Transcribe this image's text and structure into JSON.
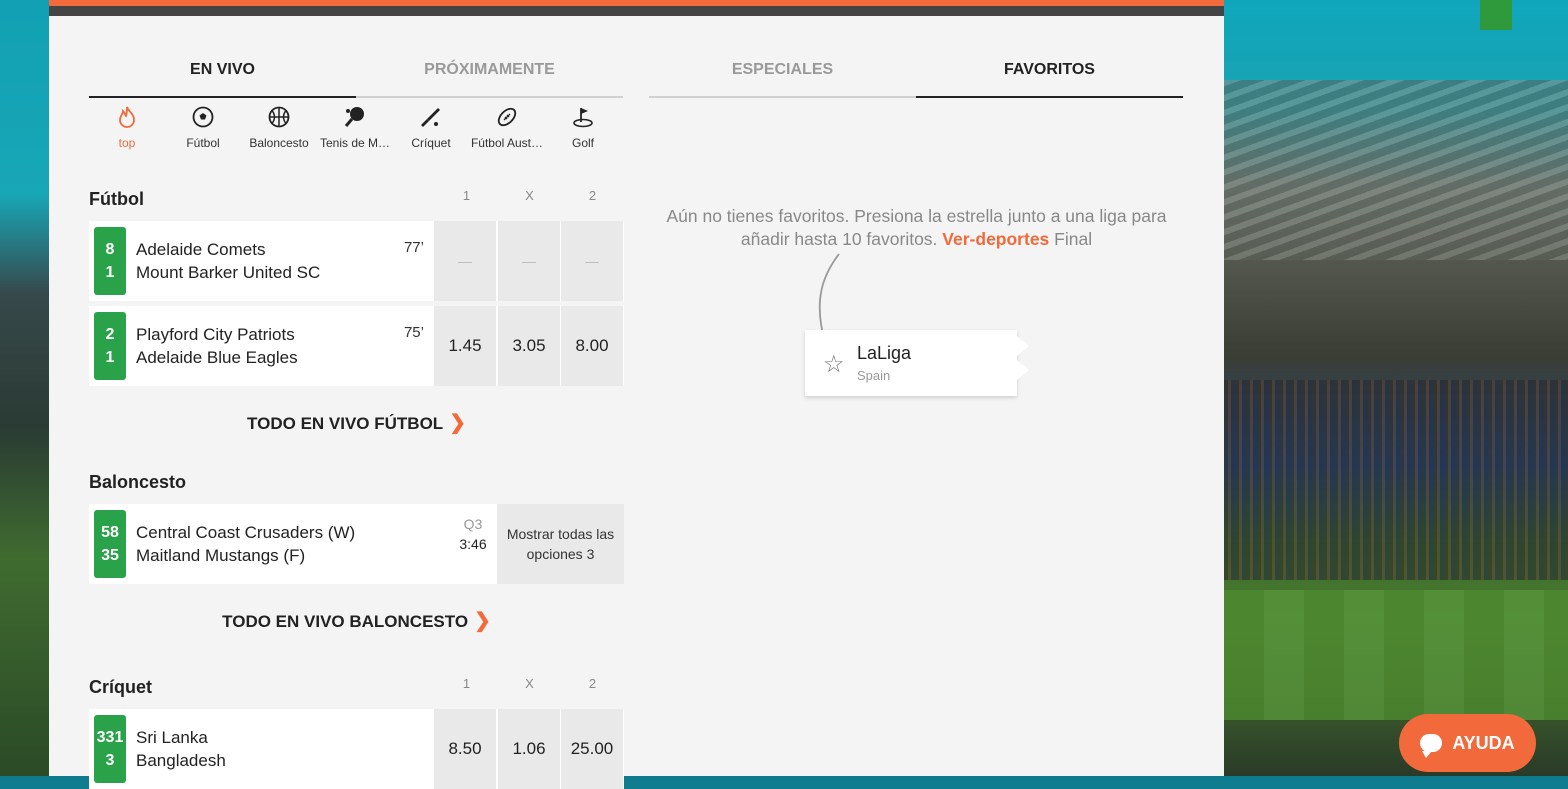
{
  "tabs_left": [
    {
      "label": "EN VIVO",
      "active": true
    },
    {
      "label": "PRÓXIMAMENTE",
      "active": false
    }
  ],
  "tabs_right": [
    {
      "label": "ESPECIALES",
      "active": false
    },
    {
      "label": "FAVORITOS",
      "active": true
    }
  ],
  "sports": [
    {
      "label": "top",
      "icon": "fire-icon",
      "active": true
    },
    {
      "label": "Fútbol",
      "icon": "soccer-ball-icon",
      "active": false
    },
    {
      "label": "Baloncesto",
      "icon": "basketball-icon",
      "active": false
    },
    {
      "label": "Tenis de M…",
      "icon": "table-tennis-icon",
      "active": false
    },
    {
      "label": "Críquet",
      "icon": "cricket-bat-icon",
      "active": false
    },
    {
      "label": "Fútbol Aust…",
      "icon": "rugby-ball-icon",
      "active": false
    },
    {
      "label": "Golf",
      "icon": "golf-icon",
      "active": false
    }
  ],
  "football": {
    "title": "Fútbol",
    "cols": [
      "1",
      "X",
      "2"
    ],
    "matches": [
      {
        "s1": "8",
        "s2": "1",
        "t1": "Adelaide Comets",
        "t2": "Mount Barker United SC",
        "time": "77’",
        "odds": [
          "—",
          "—",
          "—"
        ]
      },
      {
        "s1": "2",
        "s2": "1",
        "t1": "Playford City Patriots",
        "t2": "Adelaide Blue Eagles",
        "time": "75’",
        "odds": [
          "1.45",
          "3.05",
          "8.00"
        ]
      }
    ],
    "see_all": "TODO EN VIVO FÚTBOL"
  },
  "basketball": {
    "title": "Baloncesto",
    "matches": [
      {
        "s1": "58",
        "s2": "35",
        "t1": "Central Coast Crusaders (W)",
        "t2": "Maitland Mustangs (F)",
        "quarter": "Q3",
        "time": "3:46",
        "more": "Mostrar todas las opciones 3"
      }
    ],
    "see_all": "TODO EN VIVO BALONCESTO"
  },
  "cricket": {
    "title": "Críquet",
    "cols": [
      "1",
      "X",
      "2"
    ],
    "matches": [
      {
        "s1": "331",
        "s2": "3",
        "t1": "Sri Lanka",
        "t2": "Bangladesh",
        "odds": [
          "8.50",
          "1.06",
          "25.00"
        ]
      }
    ]
  },
  "favorites": {
    "message": "Aún no tienes favoritos. Presiona la estrella junto a una liga para añadir hasta 10 favoritos.",
    "link": "Ver-deportes",
    "suffix": "Final",
    "example_league": "LaLiga",
    "example_country": "Spain"
  },
  "help": {
    "label": "AYUDA",
    "icon": "chat-bubble-icon"
  },
  "colors": {
    "accent": "#f26a3b",
    "score_green": "#2aa24a"
  }
}
